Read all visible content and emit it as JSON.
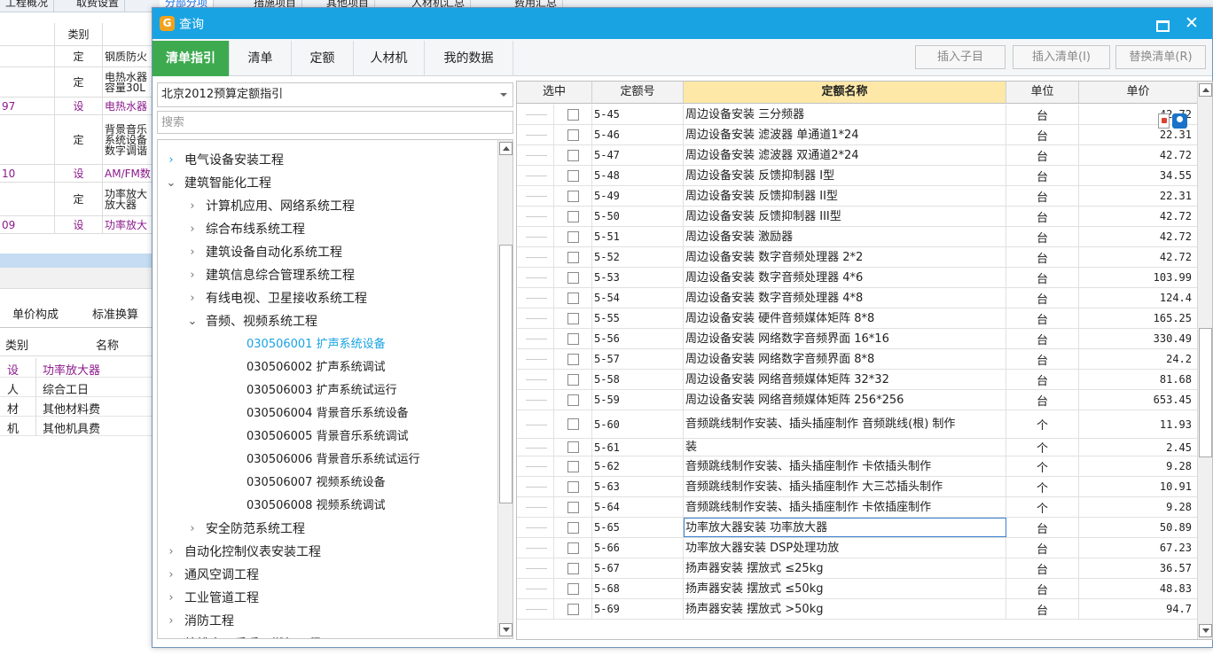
{
  "background": {
    "tabs": [
      "工程概况",
      "取费设置",
      "分部分项",
      "措施项目",
      "其他项目",
      "人材机汇总",
      "费用汇总"
    ],
    "table_header": {
      "col2": "类别"
    },
    "rows": [
      {
        "c2": "定",
        "c3": "钢质防火",
        "purple": false
      },
      {
        "c2": "定",
        "c3": "电热水器 容量30L",
        "purple": false
      },
      {
        "c1": "97",
        "c2": "设",
        "c3": "电热水器",
        "purple": true
      },
      {
        "c2": "定",
        "c3": "背景音乐系统设备 数字调谐",
        "purple": false
      },
      {
        "c1": "10",
        "c2": "设",
        "c3": "AM/FM数",
        "purple": true
      },
      {
        "c2": "定",
        "c3": "功率放大 放大器",
        "purple": false
      },
      {
        "c1": "09",
        "c2": "设",
        "c3": "功率放大",
        "purple": true
      }
    ],
    "subtabs": [
      "单价构成",
      "标准换算"
    ],
    "table2_header": {
      "kind": "类别",
      "name": "名称"
    },
    "table2_rows": [
      {
        "kind": "设",
        "name": "功率放大器",
        "purple": true
      },
      {
        "kind": "人",
        "name": "综合工日",
        "purple": false
      },
      {
        "kind": "材",
        "name": "其他材料费",
        "purple": false
      },
      {
        "kind": "机",
        "name": "其他机具费",
        "purple": false
      }
    ]
  },
  "dialog": {
    "title": "查询",
    "logo": "G",
    "close_glyph": "✕",
    "tabs": [
      "清单指引",
      "清单",
      "定额",
      "人材机",
      "我的数据"
    ],
    "buttons": {
      "insert_child": "插入子目",
      "insert_list": "插入清单(I)",
      "replace_list": "替换清单(R)"
    },
    "guide_select": "北京2012预算定额指引",
    "search_placeholder": "搜索",
    "tree": [
      {
        "label": "电气设备安装工程",
        "level": 0,
        "arrow": "›",
        "arrowClass": "blue"
      },
      {
        "label": "建筑智能化工程",
        "level": 0,
        "arrow": "⌄",
        "arrowClass": "open"
      },
      {
        "label": "计算机应用、网络系统工程",
        "level": 1,
        "arrow": "›"
      },
      {
        "label": "综合布线系统工程",
        "level": 1,
        "arrow": "›"
      },
      {
        "label": "建筑设备自动化系统工程",
        "level": 1,
        "arrow": "›"
      },
      {
        "label": "建筑信息综合管理系统工程",
        "level": 1,
        "arrow": "›"
      },
      {
        "label": "有线电视、卫星接收系统工程",
        "level": 1,
        "arrow": "›"
      },
      {
        "label": "音频、视频系统工程",
        "level": 1,
        "arrow": "⌄",
        "arrowClass": "open"
      },
      {
        "label": "030506001  扩声系统设备",
        "level": 2,
        "selected": true
      },
      {
        "label": "030506002  扩声系统调试",
        "level": 2
      },
      {
        "label": "030506003  扩声系统试运行",
        "level": 2
      },
      {
        "label": "030506004  背景音乐系统设备",
        "level": 2
      },
      {
        "label": "030506005  背景音乐系统调试",
        "level": 2
      },
      {
        "label": "030506006  背景音乐系统试运行",
        "level": 2
      },
      {
        "label": "030506007  视频系统设备",
        "level": 2
      },
      {
        "label": "030506008  视频系统调试",
        "level": 2
      },
      {
        "label": "安全防范系统工程",
        "level": 1,
        "arrow": "›"
      },
      {
        "label": "自动化控制仪表安装工程",
        "level": 0,
        "arrow": "›"
      },
      {
        "label": "通风空调工程",
        "level": 0,
        "arrow": "›"
      },
      {
        "label": "工业管道工程",
        "level": 0,
        "arrow": "›"
      },
      {
        "label": "消防工程",
        "level": 0,
        "arrow": "›"
      },
      {
        "label": "给排水、采暖、燃气工程",
        "level": 0,
        "arrow": "›"
      }
    ],
    "grid": {
      "headers": {
        "select": "选中",
        "code": "定额号",
        "name": "定额名称",
        "unit": "单位",
        "price": "单价"
      },
      "rows": [
        {
          "code": "5-45",
          "name": "周边设备安装 三分频器",
          "unit": "台",
          "price": "42.72"
        },
        {
          "code": "5-46",
          "name": "周边设备安装 滤波器 单通道1*24",
          "unit": "台",
          "price": "22.31"
        },
        {
          "code": "5-47",
          "name": "周边设备安装 滤波器 双通道2*24",
          "unit": "台",
          "price": "42.72"
        },
        {
          "code": "5-48",
          "name": "周边设备安装 反馈抑制器 I型",
          "unit": "台",
          "price": "34.55"
        },
        {
          "code": "5-49",
          "name": "周边设备安装 反馈抑制器 II型",
          "unit": "台",
          "price": "22.31"
        },
        {
          "code": "5-50",
          "name": "周边设备安装 反馈抑制器 III型",
          "unit": "台",
          "price": "42.72"
        },
        {
          "code": "5-51",
          "name": "周边设备安装 激励器",
          "unit": "台",
          "price": "42.72"
        },
        {
          "code": "5-52",
          "name": "周边设备安装 数字音频处理器 2*2",
          "unit": "台",
          "price": "42.72"
        },
        {
          "code": "5-53",
          "name": "周边设备安装 数字音频处理器 4*6",
          "unit": "台",
          "price": "103.99"
        },
        {
          "code": "5-54",
          "name": "周边设备安装 数字音频处理器 4*8",
          "unit": "台",
          "price": "124.4"
        },
        {
          "code": "5-55",
          "name": "周边设备安装 硬件音频媒体矩阵 8*8",
          "unit": "台",
          "price": "165.25"
        },
        {
          "code": "5-56",
          "name": "周边设备安装 网络数字音频界面 16*16",
          "unit": "台",
          "price": "330.49"
        },
        {
          "code": "5-57",
          "name": "周边设备安装 网络数字音频界面 8*8",
          "unit": "台",
          "price": "24.2"
        },
        {
          "code": "5-58",
          "name": "周边设备安装 网络音频媒体矩阵 32*32",
          "unit": "台",
          "price": "81.68"
        },
        {
          "code": "5-59",
          "name": "周边设备安装 网络音频媒体矩阵 256*256",
          "unit": "台",
          "price": "653.45"
        },
        {
          "code": "5-60",
          "name": "音频跳线制作安装、插头插座制作 音频跳线(根) 制作",
          "unit": "个",
          "price": "11.93",
          "tall": true
        },
        {
          "code": "5-61",
          "name": "装",
          "unit": "个",
          "price": "2.45",
          "short": true
        },
        {
          "code": "5-62",
          "name": "音频跳线制作安装、插头插座制作 卡侬插头制作",
          "unit": "个",
          "price": "9.28"
        },
        {
          "code": "5-63",
          "name": "音频跳线制作安装、插头插座制作 大三芯插头制作",
          "unit": "个",
          "price": "10.91"
        },
        {
          "code": "5-64",
          "name": "音频跳线制作安装、插头插座制作 卡侬插座制作",
          "unit": "个",
          "price": "9.28"
        },
        {
          "code": "5-65",
          "name": "功率放大器安装 功率放大器",
          "unit": "台",
          "price": "50.89",
          "focus": true
        },
        {
          "code": "5-66",
          "name": "功率放大器安装 DSP处理功放",
          "unit": "台",
          "price": "67.23"
        },
        {
          "code": "5-67",
          "name": "扬声器安装 摆放式 ≤25kg",
          "unit": "台",
          "price": "36.57"
        },
        {
          "code": "5-68",
          "name": "扬声器安装 摆放式 ≤50kg",
          "unit": "台",
          "price": "48.83"
        },
        {
          "code": "5-69",
          "name": "扬声器安装 摆放式 >50kg",
          "unit": "台",
          "price": "94.7"
        }
      ]
    }
  },
  "colors": {
    "title_bar": "#19a3e2",
    "active_tab": "#3daa4f",
    "header_highlight": "#fde8a8",
    "selected_tree": "#19a3e2"
  }
}
